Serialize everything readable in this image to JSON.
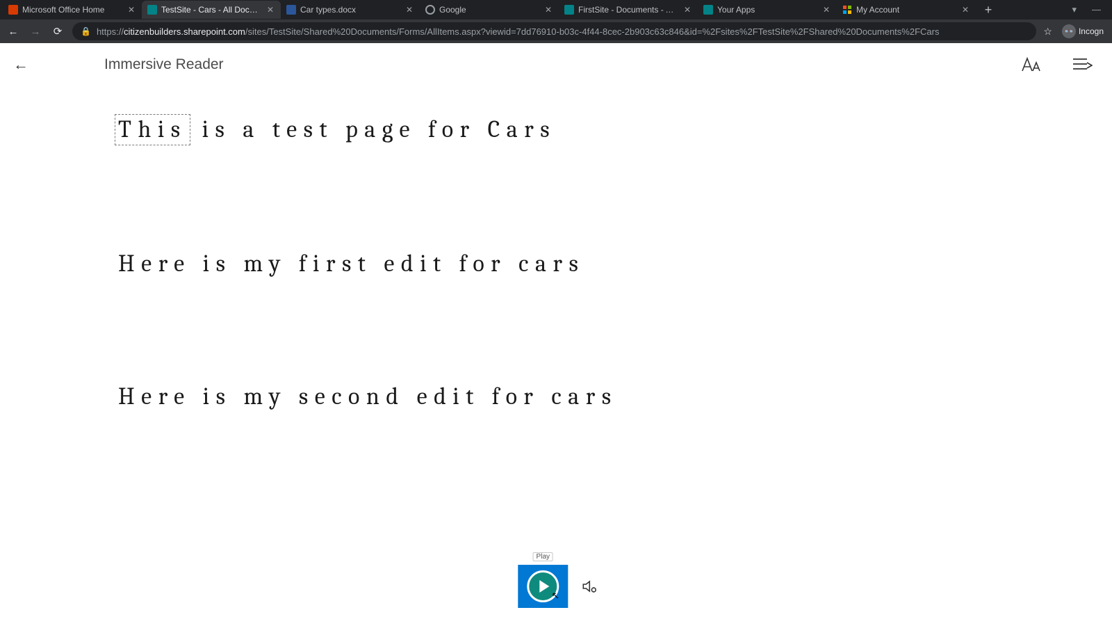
{
  "browser": {
    "tabs": [
      {
        "title": "Microsoft Office Home",
        "active": false,
        "icon": "office"
      },
      {
        "title": "TestSite - Cars - All Documents",
        "active": true,
        "icon": "sharepoint"
      },
      {
        "title": "Car types.docx",
        "active": false,
        "icon": "word"
      },
      {
        "title": "Google",
        "active": false,
        "icon": "google"
      },
      {
        "title": "FirstSite - Documents - All Docu",
        "active": false,
        "icon": "sharepoint"
      },
      {
        "title": "Your Apps",
        "active": false,
        "icon": "sharepoint"
      },
      {
        "title": "My Account",
        "active": false,
        "icon": "ms"
      }
    ],
    "url_host": "citizenbuilders.sharepoint.com",
    "url_path": "/sites/TestSite/Shared%20Documents/Forms/AllItems.aspx?viewid=7dd76910-b03c-4f44-8cec-2b903c63c846&id=%2Fsites%2FTestSite%2FShared%20Documents%2FCars",
    "incognito_label": "Incogn"
  },
  "reader": {
    "title": "Immersive Reader",
    "paragraphs": [
      {
        "highlight_first_word": "This",
        "rest": "is a test page for Cars"
      },
      {
        "text": "Here is my first edit for cars"
      },
      {
        "text": "Here is my second edit for cars"
      }
    ],
    "play_tooltip": "Play"
  }
}
